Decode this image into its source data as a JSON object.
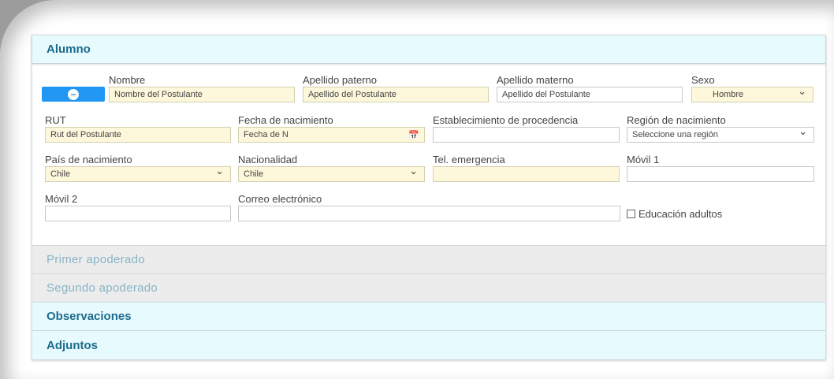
{
  "sections": {
    "alumno": "Alumno",
    "primer_apoderado": "Primer apoderado",
    "segundo_apoderado": "Segundo apoderado",
    "observaciones": "Observaciones",
    "adjuntos": "Adjuntos"
  },
  "form": {
    "nombre": {
      "label": "Nombre",
      "value": "Nombre del Postulante"
    },
    "apellido_paterno": {
      "label": "Apellido paterno",
      "value": "Apellido del Postulante"
    },
    "apellido_materno": {
      "label": "Apellido materno",
      "value": "Apellido del Postulante"
    },
    "sexo": {
      "label": "Sexo",
      "value": "Hombre"
    },
    "rut": {
      "label": "RUT",
      "value": "Rut del Postulante"
    },
    "fecha_nacimiento": {
      "label": "Fecha de nacimiento",
      "value": "Fecha de N"
    },
    "establecimiento": {
      "label": "Establecimiento de procedencia",
      "value": ""
    },
    "region": {
      "label": "Región de nacimiento",
      "value": "Seleccione una región"
    },
    "pais": {
      "label": "País de nacimiento",
      "value": "Chile"
    },
    "nacionalidad": {
      "label": "Nacionalidad",
      "value": "Chile"
    },
    "tel_emergencia": {
      "label": "Tel. emergencia",
      "value": ""
    },
    "movil1": {
      "label": "Móvil 1",
      "value": ""
    },
    "movil2": {
      "label": "Móvil 2",
      "value": ""
    },
    "correo": {
      "label": "Correo electrónico",
      "value": ""
    },
    "educacion_adultos": {
      "label": "Educación adultos",
      "checked": false
    }
  },
  "colors": {
    "accent": "#2196f3",
    "header_bg": "#e7fbfe",
    "header_text": "#1c6b8c",
    "required_bg": "#fdf8dc",
    "disabled_header_bg": "#ececec"
  },
  "icons": {
    "remove": "minus-circle-icon",
    "calendar": "calendar-icon",
    "dropdown": "chevron-down-icon"
  }
}
